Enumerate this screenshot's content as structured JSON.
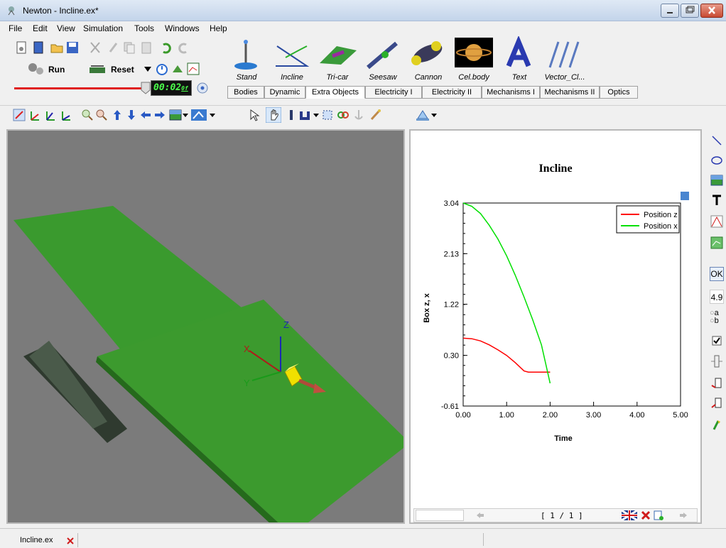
{
  "window": {
    "title": "Newton - Incline.ex*"
  },
  "menu": [
    "File",
    "Edit",
    "View",
    "Simulation",
    "Tools",
    "Windows",
    "Help"
  ],
  "controls": {
    "run_label": "Run",
    "reset_label": "Reset",
    "timer": "00:02",
    "timer_suffix": "0f"
  },
  "objects": [
    {
      "label": "Stand",
      "icon": "stand-icon"
    },
    {
      "label": "Incline",
      "icon": "incline-icon"
    },
    {
      "label": "Tri-car",
      "icon": "tricar-icon"
    },
    {
      "label": "Seesaw",
      "icon": "seesaw-icon"
    },
    {
      "label": "Cannon",
      "icon": "cannon-icon"
    },
    {
      "label": "Cel.body",
      "icon": "celestial-body-icon"
    },
    {
      "label": "Text",
      "icon": "text-icon"
    },
    {
      "label": "Vector_Cl...",
      "icon": "vector-icon"
    }
  ],
  "tabs": [
    "Bodies",
    "Dynamic",
    "Extra Objects",
    "Electricity I",
    "Electricity II",
    "Mechanisms I",
    "Mechanisms II",
    "Optics"
  ],
  "active_tab": "Extra Objects",
  "scene": {
    "axes": [
      "X",
      "Y",
      "Z"
    ]
  },
  "graph": {
    "pager": "[ 1 / 1 ]"
  },
  "rightbar": {
    "ok_label": "OK",
    "number_value": "4.9",
    "radio_a": "a",
    "radio_b": "b"
  },
  "status": {
    "file_tab": "Incline.ex"
  },
  "colors": {
    "series_z": "#ff0000",
    "series_x": "#00e000",
    "plane": "#3c9a2e",
    "box": "#f0e000"
  },
  "chart_data": {
    "type": "line",
    "title": "Incline",
    "xlabel": "Time",
    "ylabel": "Box z, x",
    "xlim": [
      0,
      5
    ],
    "ylim": [
      -0.61,
      3.04
    ],
    "xticks": [
      "0.00",
      "1.00",
      "2.00",
      "3.00",
      "4.00",
      "5.00"
    ],
    "yticks": [
      "-0.61",
      "0.30",
      "1.22",
      "2.13",
      "3.04"
    ],
    "legend_position": "top-right",
    "grid": true,
    "series": [
      {
        "name": "Position z",
        "color": "#ff0000",
        "x": [
          0,
          0.2,
          0.4,
          0.6,
          0.8,
          1.0,
          1.2,
          1.4,
          1.5,
          1.7,
          2.0
        ],
        "y": [
          0.61,
          0.6,
          0.56,
          0.49,
          0.4,
          0.3,
          0.17,
          0.02,
          0.0,
          0.0,
          0.0
        ]
      },
      {
        "name": "Position x",
        "color": "#00e000",
        "x": [
          0,
          0.2,
          0.4,
          0.6,
          0.8,
          1.0,
          1.2,
          1.4,
          1.6,
          1.8,
          2.0
        ],
        "y": [
          3.04,
          2.98,
          2.85,
          2.64,
          2.39,
          2.09,
          1.74,
          1.35,
          0.94,
          0.49,
          -0.2
        ]
      }
    ]
  }
}
